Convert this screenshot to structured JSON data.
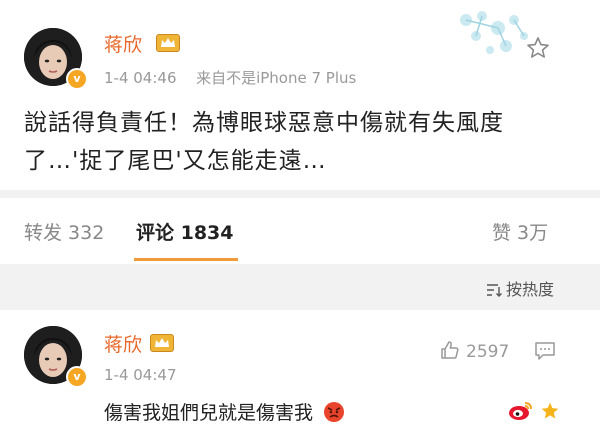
{
  "post": {
    "author": "蒋欣",
    "time": "1-4 04:46",
    "source": "来自不是iPhone 7 Plus",
    "text_line1": "說話得負責任！為博眼球惡意中傷就有失風度",
    "text_line2": "了…'捉了尾巴'又怎能走遠…"
  },
  "tabs": {
    "repost": "转发 332",
    "comments": "评论 1834",
    "like": "赞 3万"
  },
  "sort": {
    "label": "按热度"
  },
  "comment": {
    "author": "蒋欣",
    "time": "1-4 04:47",
    "likes": "2597",
    "text": "傷害我姐們兒就是傷害我"
  },
  "colors": {
    "accent_orange": "#e8682b",
    "tab_underline": "#f29a3a",
    "badge_gold": "#f5a623",
    "background_gray": "#f2f2f2"
  }
}
